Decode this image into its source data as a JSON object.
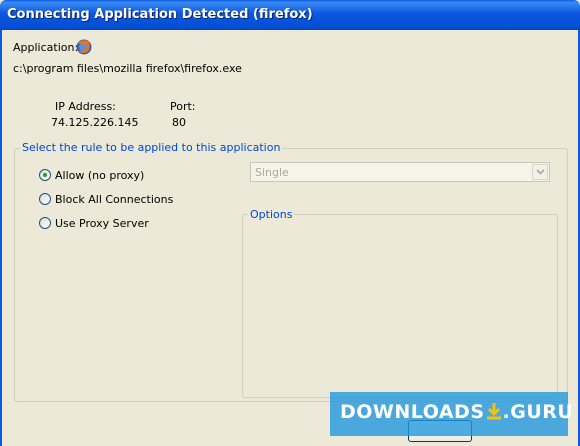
{
  "window": {
    "title": "Connecting Application Detected (firefox)"
  },
  "application": {
    "label": "Application:",
    "icon": "firefox-icon",
    "path": "c:\\program files\\mozilla firefox\\firefox.exe"
  },
  "connection": {
    "ip_label": "IP Address:",
    "ip_value": "74.125.226.145",
    "port_label": "Port:",
    "port_value": "80"
  },
  "rules": {
    "legend": "Select the rule to be applied to this application",
    "options": [
      {
        "label": "Allow (no proxy)",
        "selected": true
      },
      {
        "label": "Block All Connections",
        "selected": false
      },
      {
        "label": "Use Proxy Server",
        "selected": false
      }
    ],
    "proxy_mode": {
      "value": "Single",
      "disabled": true
    },
    "options_group_legend": "Options"
  },
  "watermark": {
    "text": "DOWNLOADS",
    "suffix": ".GURU"
  },
  "colors": {
    "accent": "#0046d5",
    "titlebar": "#0b58df",
    "selected_dot": "#21a121"
  }
}
